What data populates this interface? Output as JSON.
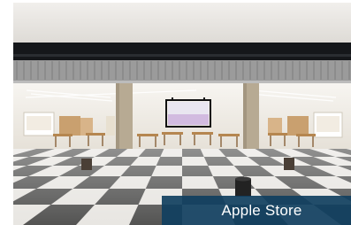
{
  "photo": {
    "subject": "apple-store-interior-photo",
    "colors": {
      "ceiling": "#e9e7e4",
      "fascia": "#15171a",
      "floor_dark": "#3a3a3a",
      "floor_light": "#e8e6e2",
      "column": "#b7aa93"
    }
  },
  "caption": {
    "text": "Apple Store",
    "background": "#103f60"
  }
}
